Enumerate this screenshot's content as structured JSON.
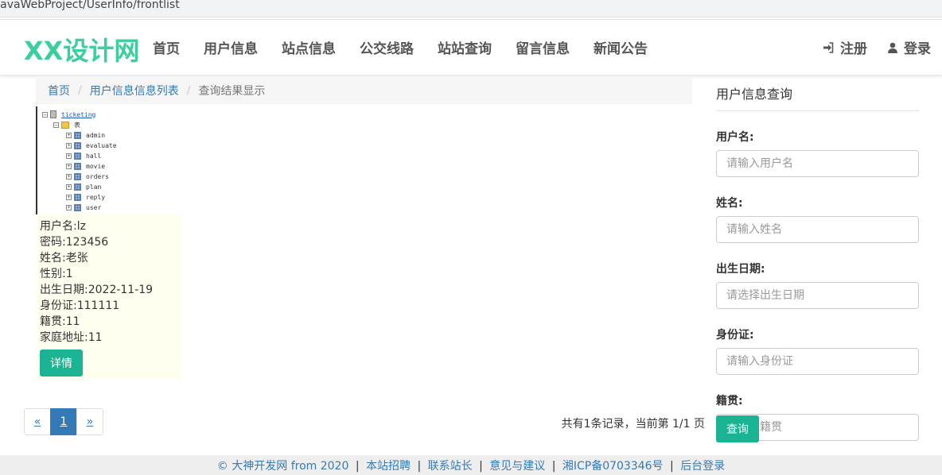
{
  "browser": {
    "url": "JavaWebProject/UserInfo/frontlist"
  },
  "navbar": {
    "brand": "XX设计网",
    "links": [
      "首页",
      "用户信息",
      "站点信息",
      "公交线路",
      "站站查询",
      "留言信息",
      "新闻公告"
    ],
    "register": "注册",
    "login": "登录"
  },
  "breadcrumb": {
    "home": "首页",
    "list": "用户信息信息列表",
    "current": "查询结果显示"
  },
  "tree": {
    "root": "ticketing",
    "folder": "表",
    "tables": [
      "admin",
      "evaluate",
      "hall",
      "movie",
      "orders",
      "plan",
      "reply",
      "user"
    ]
  },
  "user_card": {
    "lines": [
      "用户名:lz",
      "密码:123456",
      "姓名:老张",
      "性别:1",
      "出生日期:2022-11-19",
      "身份证:111111",
      "籍贯:11",
      "家庭地址:11"
    ],
    "detail_button": "详情"
  },
  "pagination": {
    "prev": "«",
    "pages": [
      "1"
    ],
    "active_page": "1",
    "next": "»",
    "summary": "共有1条记录，当前第 1/1 页"
  },
  "sidebar": {
    "title": "用户信息查询",
    "fields": [
      {
        "label": "用户名:",
        "placeholder": "请输入用户名"
      },
      {
        "label": "姓名:",
        "placeholder": "请输入姓名"
      },
      {
        "label": "出生日期:",
        "placeholder": "请选择出生日期"
      },
      {
        "label": "身份证:",
        "placeholder": "请输入身份证"
      },
      {
        "label": "籍贯:",
        "placeholder": "请输入籍贯"
      }
    ],
    "query_button": "查询"
  },
  "footer": {
    "copyright": "© 大神开发网 from 2020",
    "links": [
      "本站招聘",
      "联系站长",
      "意见与建议",
      "湘ICP备0703346号",
      "后台登录"
    ]
  },
  "colors": {
    "brand": "#3ccf9d",
    "primary_button": "#1ab394",
    "link": "#337ab7"
  }
}
